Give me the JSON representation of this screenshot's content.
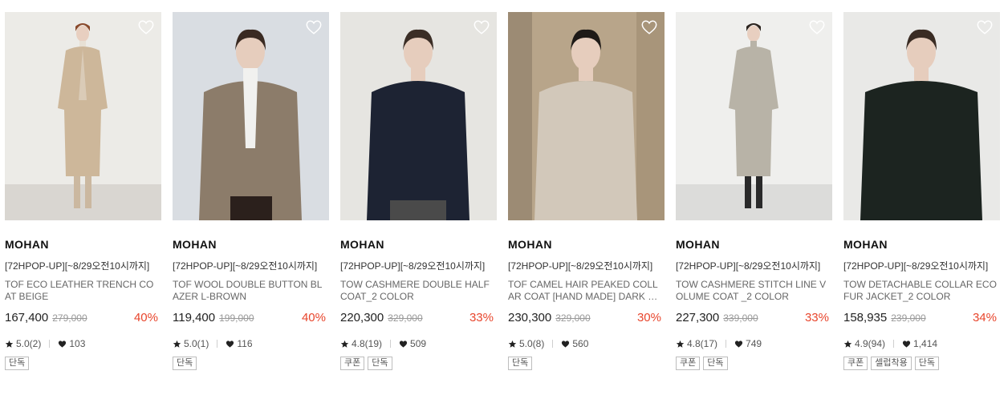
{
  "products": [
    {
      "brand": "MOHAN",
      "promo": "[72HPOP-UP][~8/29오전10시까지]",
      "name": "TOF ECO LEATHER TRENCH COAT BEIGE",
      "price": "167,400",
      "original_price": "279,000",
      "discount": "40%",
      "rating": "5.0(2)",
      "likes": "103",
      "tags": [
        "단독"
      ],
      "photo": {
        "bg": "#ecebe7",
        "floor": "#d9d6d1",
        "coat": "#cdb79a",
        "inner": "#e7e0d4",
        "hair": "#8a4a2c",
        "legs": "#cbb8a0",
        "style": "trench-full"
      }
    },
    {
      "brand": "MOHAN",
      "promo": "[72HPOP-UP][~8/29오전10시까지]",
      "name": "TOF WOOL DOUBLE BUTTON BLAZER L-BROWN",
      "price": "119,400",
      "original_price": "199,000",
      "discount": "40%",
      "rating": "5.0(1)",
      "likes": "116",
      "tags": [
        "단독"
      ],
      "photo": {
        "bg": "#d9dde2",
        "floor": "#d9dde2",
        "coat": "#8c7c6a",
        "inner": "#f1f1ef",
        "hair": "#3a2a22",
        "legs": "#2b201c",
        "style": "blazer-half"
      }
    },
    {
      "brand": "MOHAN",
      "promo": "[72HPOP-UP][~8/29오전10시까지]",
      "name": "TOW CASHMERE DOUBLE HALF COAT_2 COLOR",
      "price": "220,300",
      "original_price": "329,000",
      "discount": "33%",
      "rating": "4.8(19)",
      "likes": "509",
      "tags": [
        "쿠폰",
        "단독"
      ],
      "photo": {
        "bg": "#e6e5e1",
        "floor": "#e6e5e1",
        "coat": "#1d2333",
        "inner": "#1d2333",
        "hair": "#3b2e26",
        "legs": "#4a4a4a",
        "style": "peacoat-half"
      }
    },
    {
      "brand": "MOHAN",
      "promo": "[72HPOP-UP][~8/29오전10시까지]",
      "name": "TOF CAMEL HAIR PEAKED COLLAR COAT [HAND MADE] DARK OATMEAL",
      "price": "230,300",
      "original_price": "329,000",
      "discount": "30%",
      "rating": "5.0(8)",
      "likes": "560",
      "tags": [
        "단독"
      ],
      "photo": {
        "bg": "#b8a58a",
        "floor": "#9c8b74",
        "coat": "#d2c8ba",
        "inner": "#d2c8ba",
        "hair": "#1e1a17",
        "legs": "#d2c8ba",
        "style": "longcoat-knee"
      }
    },
    {
      "brand": "MOHAN",
      "promo": "[72HPOP-UP][~8/29오전10시까지]",
      "name": "TOW CASHMERE STITCH LINE VOLUME COAT _2 COLOR",
      "price": "227,300",
      "original_price": "339,000",
      "discount": "33%",
      "rating": "4.8(17)",
      "likes": "749",
      "tags": [
        "쿠폰",
        "단독"
      ],
      "photo": {
        "bg": "#efefed",
        "floor": "#dcdcda",
        "coat": "#b8b3a7",
        "inner": "#b8b3a7",
        "hair": "#2d2520",
        "legs": "#2a2a2a",
        "style": "volume-full"
      }
    },
    {
      "brand": "MOHAN",
      "promo": "[72HPOP-UP][~8/29오전10시까지]",
      "name": "TOW DETACHABLE COLLAR ECO FUR JACKET_2 COLOR",
      "price": "158,935",
      "original_price": "239,000",
      "discount": "34%",
      "rating": "4.9(94)",
      "likes": "1,414",
      "tags": [
        "쿠폰",
        "셀럽착용",
        "단독"
      ],
      "photo": {
        "bg": "#e9e9e7",
        "floor": "#e9e9e7",
        "coat": "#1c2420",
        "inner": "#1c2420",
        "hair": "#3a2c24",
        "legs": "#1c2420",
        "style": "fur-half"
      }
    }
  ]
}
